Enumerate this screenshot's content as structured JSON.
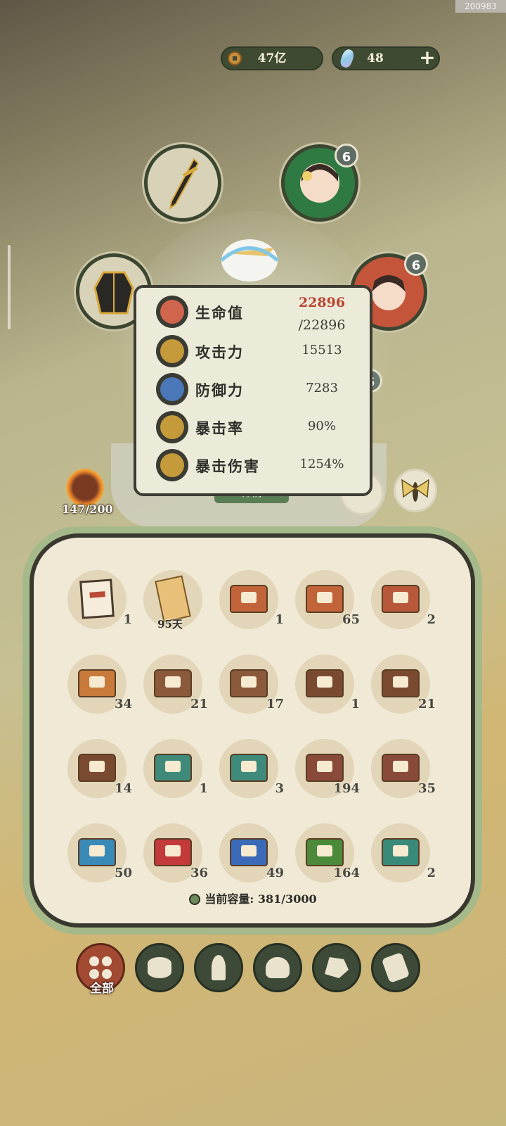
{
  "corner_id": "200983",
  "currency": {
    "coins": "47亿",
    "gems": "48",
    "coin_icon": "copper-coin-icon",
    "gem_icon": "crystal-icon",
    "plus_icon": "plus-icon"
  },
  "slots": {
    "weapon": {
      "icon": "sword-icon"
    },
    "armor": {
      "icon": "robe-icon"
    },
    "companion_top": {
      "icon": "companion-portrait",
      "level": "6"
    },
    "companion_mid": {
      "icon": "companion-portrait",
      "level": "6"
    },
    "companion_low": {
      "icon": "companion-portrait",
      "level": "6"
    },
    "moth": {
      "icon": "moth-icon"
    }
  },
  "detail_button": "详情",
  "stats": {
    "hp_label": "生命值",
    "hp_current": "22896",
    "hp_max": "/22896",
    "atk_label": "攻击力",
    "atk_value": "15513",
    "def_label": "防御力",
    "def_value": "7283",
    "crit_rate_label": "暴击率",
    "crit_rate_value": "90%",
    "crit_dmg_label": "暴击伤害",
    "crit_dmg_value": "1254%",
    "colors": {
      "hp": "#b8452f",
      "atk": "#c49a3a",
      "def": "#4a78b8",
      "crit_rate": "#c49a3a",
      "crit_dmg": "#c49a3a"
    }
  },
  "energy": "147/200",
  "inventory": {
    "items": [
      {
        "kind": "hammer-card",
        "count": "1"
      },
      {
        "kind": "scroll",
        "count": "95天"
      },
      {
        "kind": "chest",
        "color": "#c2643a",
        "count": "1"
      },
      {
        "kind": "chest",
        "color": "#c2643a",
        "count": "65"
      },
      {
        "kind": "chest",
        "color": "#b8583a",
        "count": "2"
      },
      {
        "kind": "chest",
        "color": "#c77a3a",
        "count": "34"
      },
      {
        "kind": "chest",
        "color": "#8a5a3a",
        "count": "21"
      },
      {
        "kind": "chest",
        "color": "#8a5a3a",
        "count": "17"
      },
      {
        "kind": "chest",
        "color": "#7a4a30",
        "count": "1"
      },
      {
        "kind": "chest",
        "color": "#7a4a30",
        "count": "21"
      },
      {
        "kind": "chest",
        "color": "#7a4a30",
        "count": "14"
      },
      {
        "kind": "chest",
        "color": "#3f8a7a",
        "count": "1"
      },
      {
        "kind": "chest",
        "color": "#3f8a7a",
        "count": "3"
      },
      {
        "kind": "chest",
        "color": "#8a4a3a",
        "count": "194"
      },
      {
        "kind": "chest",
        "color": "#8a4a3a",
        "count": "35"
      },
      {
        "kind": "chest",
        "color": "#3a8ab8",
        "count": "50"
      },
      {
        "kind": "chest",
        "color": "#c23a3a",
        "count": "36"
      },
      {
        "kind": "chest",
        "color": "#3a6ab8",
        "count": "49"
      },
      {
        "kind": "chest",
        "color": "#4a8a3a",
        "count": "164"
      },
      {
        "kind": "chest",
        "color": "#3a8a7a",
        "count": "2"
      }
    ],
    "capacity_label": "当前容量:",
    "capacity_value": "381/3000"
  },
  "tabs": {
    "active_label": "全部",
    "items": [
      "grid-icon",
      "log-icon",
      "herb-icon",
      "rice-bowl-icon",
      "ore-icon",
      "scroll-map-icon"
    ]
  }
}
